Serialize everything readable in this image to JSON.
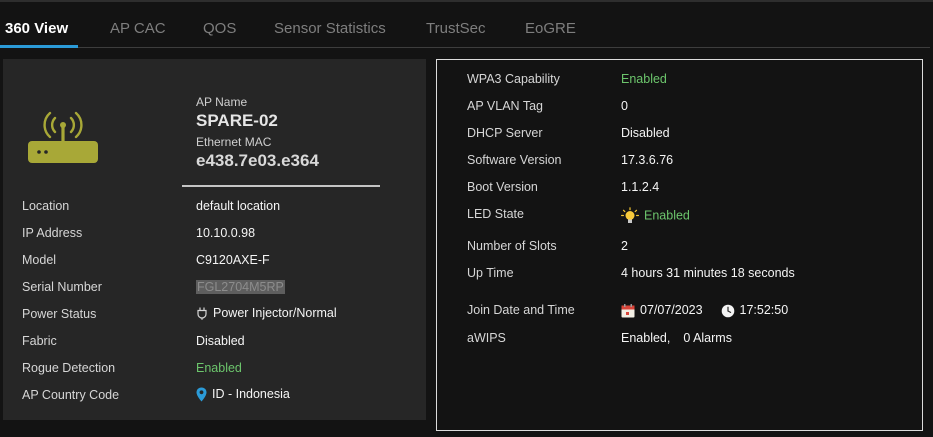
{
  "tabs": [
    {
      "label": "360 View",
      "active": true
    },
    {
      "label": "AP CAC",
      "active": false
    },
    {
      "label": "QOS",
      "active": false
    },
    {
      "label": "Sensor Statistics",
      "active": false
    },
    {
      "label": "TrustSec",
      "active": false
    },
    {
      "label": "EoGRE",
      "active": false
    }
  ],
  "colors": {
    "accent": "#2b9bd8",
    "enabled_green": "#6cc56c",
    "icon_olive": "#a8a837"
  },
  "ap": {
    "icon": "access-point-icon",
    "name_label": "AP Name",
    "name": "SPARE-02",
    "mac_label": "Ethernet MAC",
    "mac": "e438.7e03.e364"
  },
  "left_details": {
    "location": {
      "label": "Location",
      "value": "default location"
    },
    "ip_address": {
      "label": "IP Address",
      "value": "10.10.0.98"
    },
    "model": {
      "label": "Model",
      "value": "C9120AXE-F"
    },
    "serial_number": {
      "label": "Serial Number",
      "value": "FGL2704M5RP"
    },
    "power_status": {
      "label": "Power Status",
      "value": "Power Injector/Normal",
      "icon": "power-plug-icon"
    },
    "fabric": {
      "label": "Fabric",
      "value": "Disabled"
    },
    "rogue_detection": {
      "label": "Rogue Detection",
      "value": "Enabled"
    },
    "country_code": {
      "label": "AP Country Code",
      "value": "ID - Indonesia",
      "icon": "map-pin-icon"
    }
  },
  "right_details": {
    "wpa3": {
      "label": "WPA3 Capability",
      "value": "Enabled"
    },
    "vlan_tag": {
      "label": "AP VLAN Tag",
      "value": "0"
    },
    "dhcp_server": {
      "label": "DHCP Server",
      "value": "Disabled"
    },
    "software_version": {
      "label": "Software Version",
      "value": "17.3.6.76"
    },
    "boot_version": {
      "label": "Boot Version",
      "value": "1.1.2.4"
    },
    "led_state": {
      "label": "LED State",
      "value": "Enabled",
      "icon": "lightbulb-icon"
    },
    "num_slots": {
      "label": "Number of Slots",
      "value": "2"
    },
    "up_time": {
      "label": "Up Time",
      "value": "4 hours 31 minutes 18 seconds"
    },
    "join": {
      "label": "Join Date and Time",
      "date": "07/07/2023",
      "time": "17:52:50",
      "date_icon": "calendar-icon",
      "time_icon": "clock-icon"
    },
    "awips": {
      "label": "aWIPS",
      "status": "Enabled,",
      "alarms": "0 Alarms"
    }
  }
}
